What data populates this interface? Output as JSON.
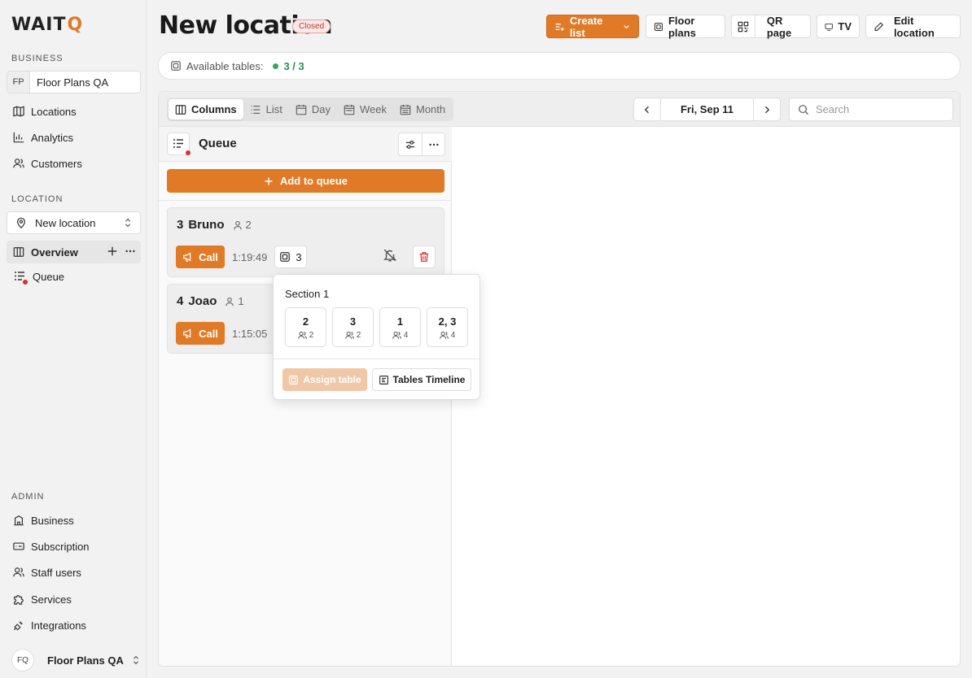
{
  "sidebar": {
    "logo": "WAITQ",
    "business_label": "BUSINESS",
    "business": {
      "initials": "FP",
      "name": "Floor Plans QA"
    },
    "business_nav": [
      {
        "label": "Locations",
        "icon": "map-icon"
      },
      {
        "label": "Analytics",
        "icon": "bar-chart-icon"
      },
      {
        "label": "Customers",
        "icon": "users-icon"
      }
    ],
    "location_label": "LOCATION",
    "location_select": "New location",
    "location_nav": [
      {
        "label": "Overview",
        "icon": "columns-icon"
      },
      {
        "label": "Queue",
        "icon": "queue-icon"
      }
    ],
    "admin_label": "ADMIN",
    "admin_nav": [
      {
        "label": "Business",
        "icon": "building-icon"
      },
      {
        "label": "Subscription",
        "icon": "card-icon"
      },
      {
        "label": "Staff users",
        "icon": "users-icon"
      },
      {
        "label": "Services",
        "icon": "puzzle-icon"
      },
      {
        "label": "Integrations",
        "icon": "plug-icon"
      }
    ],
    "user": {
      "initials": "FQ",
      "name": "Floor Plans QA"
    }
  },
  "header": {
    "title": "New location",
    "status_badge": "Closed",
    "buttons": {
      "create_list": "Create list",
      "floor_plans": "Floor plans",
      "qr_page": "QR page",
      "tv": "TV",
      "edit_location": "Edit location"
    }
  },
  "availability": {
    "label": "Available tables:",
    "value": "3 / 3",
    "status_color": "#3aa55d"
  },
  "toolbar": {
    "views": [
      "Columns",
      "List",
      "Day",
      "Week",
      "Month"
    ],
    "active_view": "Columns",
    "date": "Fri, Sep 11",
    "search_placeholder": "Search"
  },
  "queue": {
    "title": "Queue",
    "add_button": "Add to queue",
    "entries": [
      {
        "number": "3",
        "name": "Bruno",
        "party": "2",
        "call_label": "Call",
        "timer": "1:19:49",
        "table": "3"
      },
      {
        "number": "4",
        "name": "Joao",
        "party": "1",
        "call_label": "Call",
        "timer": "1:15:05"
      }
    ]
  },
  "popover": {
    "section": "Section 1",
    "tables": [
      {
        "name": "2",
        "capacity": "2"
      },
      {
        "name": "3",
        "capacity": "2"
      },
      {
        "name": "1",
        "capacity": "4"
      },
      {
        "name": "2, 3",
        "capacity": "4"
      }
    ],
    "assign_button": "Assign table",
    "timeline_button": "Tables Timeline"
  },
  "colors": {
    "accent": "#e07a26",
    "closed": "#c0392b",
    "available": "#3aa55d"
  }
}
